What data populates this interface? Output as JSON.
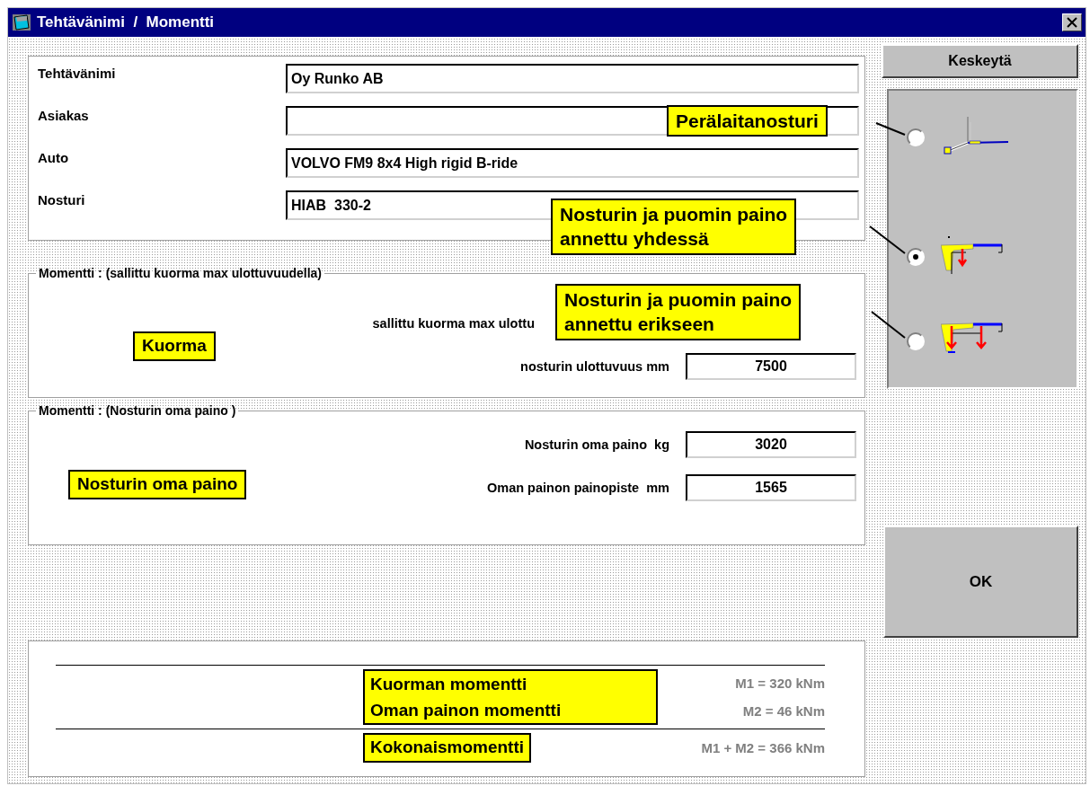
{
  "window": {
    "title": "Tehtävänimi  /  Momentti"
  },
  "info_fields": [
    {
      "label": "Tehtävänimi",
      "value": "Oy Runko AB"
    },
    {
      "label": "Asiakas"
    },
    {
      "label": "Auto",
      "value": "VOLVO FM9 8x4 High rigid B-ride"
    },
    {
      "label": "Nosturi",
      "value": "HIAB  330-2"
    }
  ],
  "load_group": {
    "title": "Momentti : (sallittu kuorma max ulottuvuudella)",
    "callout": "Kuorma",
    "rows": [
      {
        "label": "sallittu kuorma max ulottu"
      },
      {
        "label": "nosturin ulottuvuus mm",
        "value": "7500"
      }
    ]
  },
  "weight_group": {
    "title": "Momentti : (Nosturin oma paino )",
    "callout": "Nosturin oma paino",
    "rows": [
      {
        "label": "Nosturin oma paino  kg",
        "value": "3020"
      },
      {
        "label": "Oman painon painopiste  mm",
        "value": "1565"
      }
    ]
  },
  "cancel_button": "Keskeytä",
  "crane_options": [
    {
      "kind": "tailgate",
      "label": "Perälaitanosturi",
      "selected": false
    },
    {
      "kind": "combined",
      "label": "Nosturin ja puomin paino\nannettu yhdessä",
      "selected": true
    },
    {
      "kind": "separate",
      "label": "Nosturin ja puomin paino\nannettu erikseen",
      "selected": false
    }
  ],
  "ok_button": "OK",
  "results": {
    "rows": [
      {
        "label": "Kuorman momentti",
        "value": "M1 = 320 kNm"
      },
      {
        "label": "Oman painon momentti",
        "value": "M2 = 46 kNm"
      }
    ],
    "total": {
      "label": "Kokonaismomentti",
      "value": "M1 + M2 = 366 kNm"
    }
  }
}
